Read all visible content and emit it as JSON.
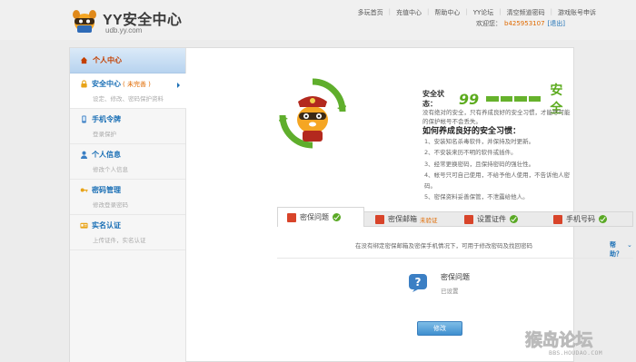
{
  "header": {
    "logo_title": "YY安全中心",
    "logo_sub": "udb.yy.com",
    "nav": [
      "多玩首页",
      "充值中心",
      "帮助中心",
      "YY论坛",
      "清空频道密码",
      "游戏账号申诉"
    ],
    "welcome_label": "欢迎您：",
    "username": "b425953107",
    "logout": "[退出]"
  },
  "sidebar": {
    "head": "个人中心",
    "items": [
      {
        "title": "安全中心",
        "badge": "( 未完善 )",
        "desc": "设定、修改、密码保护资料",
        "icon": "lock-icon"
      },
      {
        "title": "手机令牌",
        "badge": "",
        "desc": "登录保护",
        "icon": "phone-icon"
      },
      {
        "title": "个人信息",
        "badge": "",
        "desc": "修改个人信息",
        "icon": "user-icon"
      },
      {
        "title": "密码管理",
        "badge": "",
        "desc": "修改登录密码",
        "icon": "key-icon"
      },
      {
        "title": "实名认证",
        "badge": "",
        "desc": "上传证件，实名认证",
        "icon": "card-icon"
      }
    ]
  },
  "security": {
    "label": "安全状态：",
    "score": "99",
    "status": "安全",
    "bar_color": "#66b22c",
    "level_fraction": 1.0,
    "tip": "没有绝对的安全，只有养成良好的安全习惯，才能尽可能的保护帐号不会丢失。",
    "habits_title": "如何养成良好的安全习惯：",
    "habits": [
      "1、安装知名杀毒软件，并保持及时更新。",
      "2、不安装来历不明的软件或插件。",
      "3、经常更换密码，且保持密码的强壮性。",
      "4、帐号只可自己使用，不给予他人使用，不告诉他人密码。",
      "5、密保资料妥善保管，不泄露给他人。"
    ]
  },
  "tabs": [
    {
      "label": "密保问题",
      "status": "ok",
      "note": ""
    },
    {
      "label": "密保邮箱",
      "status": "none",
      "note": "未验证"
    },
    {
      "label": "设置证件",
      "status": "ok",
      "note": ""
    },
    {
      "label": "手机号码",
      "status": "ok",
      "note": ""
    }
  ],
  "panel": {
    "notice": "在没有绑定密保邮箱及密保手机情况下，可用于修改密码及找回密码",
    "help": "帮助？",
    "item_title": "密保问题",
    "item_status": "已设置",
    "button": "修改"
  },
  "watermark": {
    "text": "猴岛论坛",
    "sub": "BBS.HOUDAO.COM"
  },
  "colors": {
    "accent_blue": "#1a6fb5",
    "warning_orange": "#e06a00",
    "success_green": "#5cab1e"
  }
}
